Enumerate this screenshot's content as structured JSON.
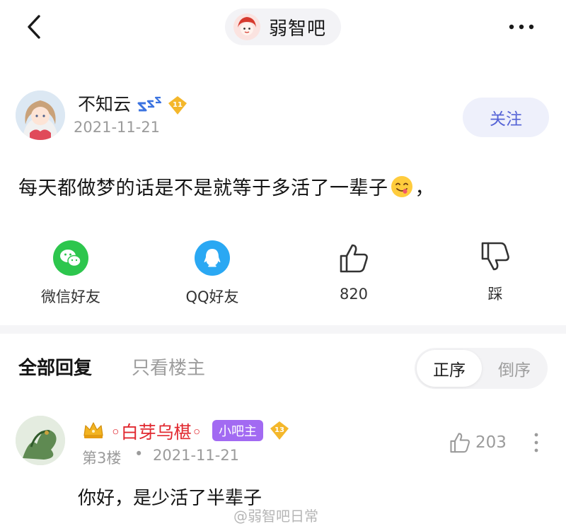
{
  "forum": {
    "name": "弱智吧",
    "avatar_icon": "forum-avatar-girl"
  },
  "post": {
    "author": "不知云",
    "level": "11",
    "date": "2021-11-21",
    "follow_label": "关注",
    "text_before": "每天都做梦的话是不是就等于多活了一辈子",
    "text_after": "，"
  },
  "actions": {
    "wechat": "微信好友",
    "qq": "QQ好友",
    "likes": "820",
    "dislike": "踩"
  },
  "tabs": {
    "all": "全部回复",
    "op_only": "只看楼主"
  },
  "order": {
    "asc": "正序",
    "desc": "倒序"
  },
  "reply": {
    "name": "◦白芽乌椹◦",
    "badge": "小吧主",
    "level": "13",
    "floor": "第3楼",
    "separator": "•",
    "date": "2021-11-21",
    "likes": "203",
    "text": "你好，是少活了半辈子"
  },
  "watermark": "@弱智吧日常",
  "colors": {
    "accent": "#5563d6",
    "wechat": "#2dc64d",
    "qq": "#2aa8f3",
    "reply_name": "#e1282f",
    "mod_badge": "#a26af2"
  }
}
